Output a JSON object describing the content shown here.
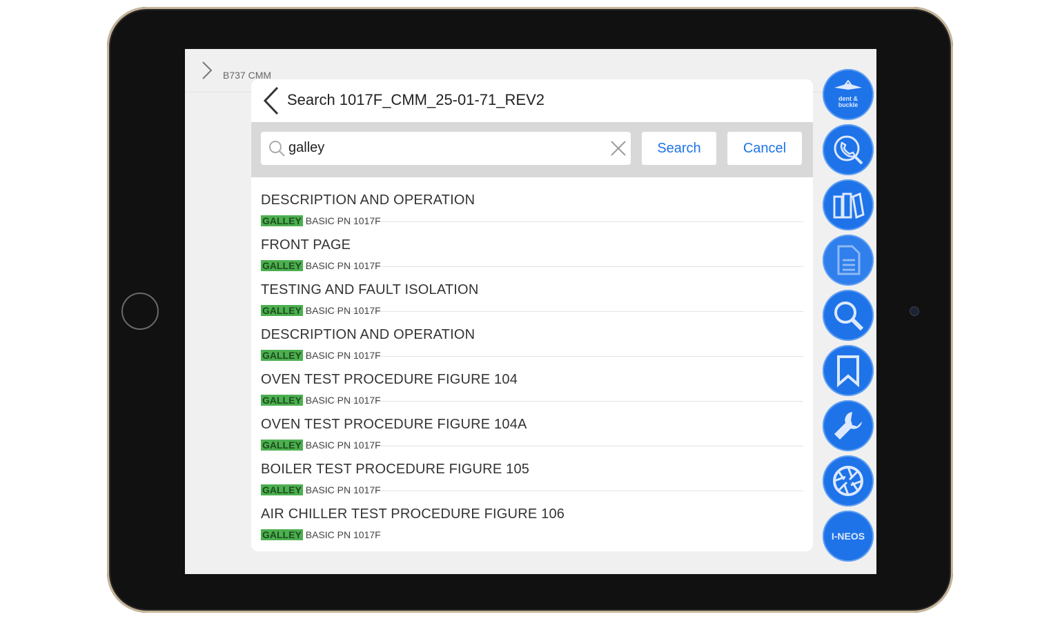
{
  "app": {
    "breadcrumb": "B737 CMM"
  },
  "panel": {
    "title": "Search 1017F_CMM_25-01-71_REV2"
  },
  "search": {
    "value": "galley",
    "search_label": "Search",
    "cancel_label": "Cancel"
  },
  "results": [
    {
      "title": "DESCRIPTION AND OPERATION",
      "highlight": "GALLEY",
      "subtitle": "BASIC PN 1017F"
    },
    {
      "title": "FRONT PAGE",
      "highlight": "GALLEY",
      "subtitle": "BASIC PN 1017F"
    },
    {
      "title": "TESTING AND FAULT ISOLATION",
      "highlight": "GALLEY",
      "subtitle": "BASIC PN 1017F"
    },
    {
      "title": "DESCRIPTION AND OPERATION",
      "highlight": "GALLEY",
      "subtitle": "BASIC PN 1017F"
    },
    {
      "title": "OVEN TEST PROCEDURE FIGURE 104",
      "highlight": "GALLEY",
      "subtitle": "BASIC PN 1017F"
    },
    {
      "title": "OVEN TEST PROCEDURE FIGURE 104A",
      "highlight": "GALLEY",
      "subtitle": "BASIC PN 1017F"
    },
    {
      "title": "BOILER TEST PROCEDURE FIGURE 105",
      "highlight": "GALLEY",
      "subtitle": "BASIC PN 1017F"
    },
    {
      "title": "AIR CHILLER TEST PROCEDURE FIGURE 106",
      "highlight": "GALLEY",
      "subtitle": "BASIC PN 1017F"
    }
  ],
  "rail": {
    "logo_text_1": "dent &",
    "logo_text_2": "buckle",
    "ineos_label": "I-NEOS",
    "icons": [
      "dent-buckle-logo-icon",
      "phone-search-icon",
      "books-icon",
      "document-icon",
      "search-icon",
      "bookmark-icon",
      "wrench-icon",
      "aperture-icon",
      "i-neos-icon"
    ]
  },
  "colors": {
    "accent": "#1e73e8",
    "highlight": "#4caf50",
    "search_bar_bg": "#d8d8d8"
  }
}
